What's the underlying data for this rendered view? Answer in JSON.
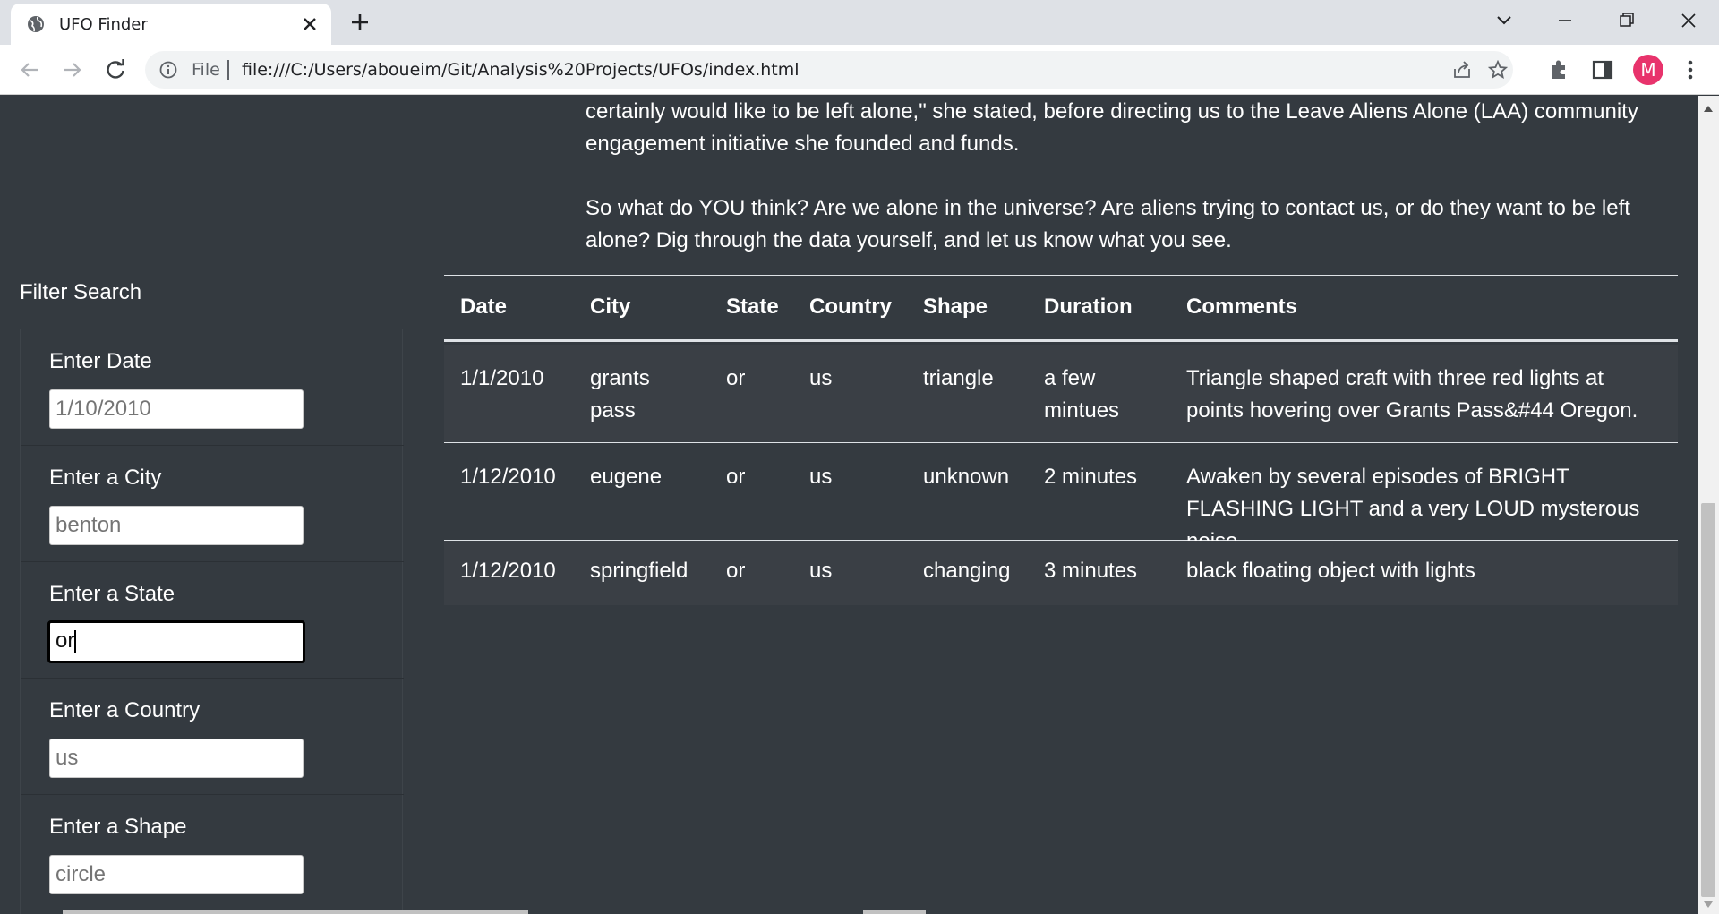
{
  "browser": {
    "tab_title": "UFO Finder",
    "url_scheme": "File",
    "url": "file:///C:/Users/aboueim/Git/Analysis%20Projects/UFOs/index.html",
    "avatar_letter": "M",
    "avatar_color": "#e8336c"
  },
  "intro": {
    "paragraph1": "certainly would like to be left alone,\" she stated, before directing us to the Leave Aliens Alone (LAA) community engagement initiative she founded and funds.",
    "paragraph2": "So what do YOU think? Are we alone in the universe? Are aliens trying to contact us, or do they want to be left alone? Dig through the data yourself, and let us know what you see."
  },
  "filters": {
    "title": "Filter Search",
    "items": [
      {
        "label": "Enter Date",
        "placeholder": "1/10/2010",
        "value": ""
      },
      {
        "label": "Enter a City",
        "placeholder": "benton",
        "value": ""
      },
      {
        "label": "Enter a State",
        "placeholder": "",
        "value": "or"
      },
      {
        "label": "Enter a Country",
        "placeholder": "us",
        "value": ""
      },
      {
        "label": "Enter a Shape",
        "placeholder": "circle",
        "value": ""
      }
    ]
  },
  "table": {
    "headers": [
      "Date",
      "City",
      "State",
      "Country",
      "Shape",
      "Duration",
      "Comments"
    ],
    "rows": [
      {
        "date": "1/1/2010",
        "city": "grants pass",
        "state": "or",
        "country": "us",
        "shape": "triangle",
        "duration": "a few mintues",
        "comments": "Triangle shaped craft with three red lights at points hovering over Grants Pass&#44 Oregon."
      },
      {
        "date": "1/12/2010",
        "city": "eugene",
        "state": "or",
        "country": "us",
        "shape": "unknown",
        "duration": "2 minutes",
        "comments": "Awaken by several episodes of BRIGHT FLASHING LIGHT and a very LOUD mysterous noise."
      },
      {
        "date": "1/12/2010",
        "city": "springfield",
        "state": "or",
        "country": "us",
        "shape": "changing",
        "duration": "3 minutes",
        "comments": "black floating object with lights"
      }
    ]
  }
}
